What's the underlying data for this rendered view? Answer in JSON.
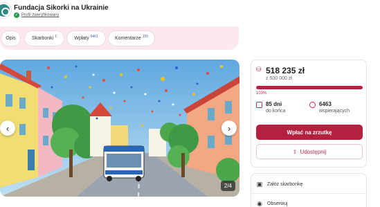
{
  "header": {
    "org_name": "Fundacja Sikorki na Ukrainie",
    "verified_label": "Profil zweryfikowany",
    "icons": {
      "logo": "org-logo",
      "verified": "check-circle-icon"
    }
  },
  "tabs": [
    {
      "label": "Opis",
      "count": ""
    },
    {
      "label": "Skarbonki",
      "count": "1"
    },
    {
      "label": "Wpłaty",
      "count": "6461"
    },
    {
      "label": "Komentarze",
      "count": "155"
    }
  ],
  "gallery": {
    "counter": "2/4",
    "prev_icon": "chevron-left-icon",
    "next_icon": "chevron-right-icon"
  },
  "fundraiser": {
    "amount": "518 235 zł",
    "goal": "z 500 000 zł",
    "percent": "103%",
    "progress": 1.0,
    "days_value": "85 dni",
    "days_label": "do końca",
    "supporters_value": "6463",
    "supporters_label": "wspierających",
    "support_button": "Wpłać na zrzutkę",
    "share_button": "Udostępnij",
    "icons": {
      "amount": "coins-icon",
      "days": "calendar-icon",
      "supporters": "people-icon",
      "share": "share-icon"
    }
  },
  "actions": {
    "create_piggybank": "Załóż skarbonkę",
    "follow": "Obserwuj",
    "icons": {
      "create_piggybank": "piggybank-icon",
      "follow": "eye-icon"
    }
  },
  "colors": {
    "brand": "#b3213f",
    "brand_light": "#fbe9ee",
    "verified": "#2b9b4e",
    "link_count": "#3f5fb0"
  }
}
